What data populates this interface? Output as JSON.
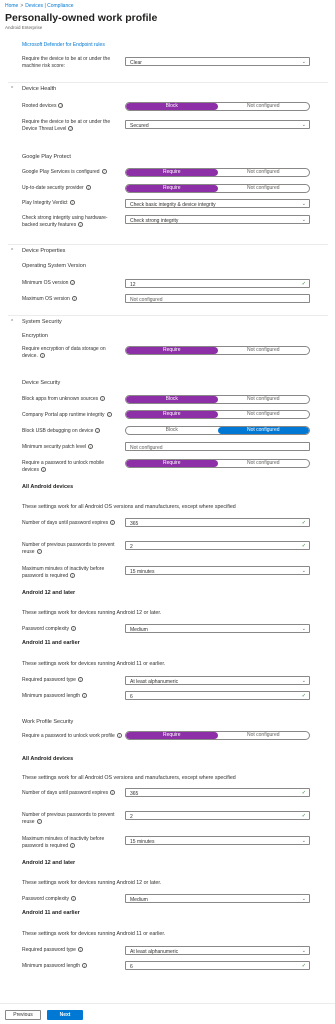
{
  "breadcrumb": {
    "home": "Home",
    "devices": "Devices | Compliance"
  },
  "page": {
    "title": "Personally-owned work profile",
    "subtitle": "Android Enterprise"
  },
  "defender_link": "Microsoft Defender for Endpoint rules",
  "risk_score": {
    "label": "Require the device to be at or under the machine risk score:",
    "value": "Clear"
  },
  "device_health": {
    "section": "Device Health",
    "rooted": {
      "label": "Rooted devices",
      "on": "Block",
      "off": "Not configured"
    },
    "threat_level": {
      "label": "Require the device to be at or under the Device Threat Level",
      "value": "Secured"
    },
    "google_play": "Google Play Protect",
    "gps_configured": {
      "label": "Google Play Services is configured",
      "on": "Require",
      "off": "Not configured"
    },
    "security_provider": {
      "label": "Up-to-date security provider",
      "on": "Require",
      "off": "Not configured"
    },
    "integrity_verdict": {
      "label": "Play Integrity Verdict",
      "value": "Check basic integrity & device integrity"
    },
    "strong_integrity": {
      "label": "Check strong integrity using hardware-backed security features",
      "value": "Check strong integrity"
    }
  },
  "device_properties": {
    "section": "Device Properties",
    "os_version": "Operating System Version",
    "min_os": {
      "label": "Minimum OS version",
      "value": "12"
    },
    "max_os": {
      "label": "Maximum OS version",
      "placeholder": "Not configured"
    }
  },
  "system_security": {
    "section": "System Security",
    "encryption": "Encryption",
    "encrypt_storage": {
      "label": "Require encryption of data storage on device.",
      "on": "Require",
      "off": "Not configured"
    },
    "device_security": "Device Security",
    "unknown_sources": {
      "label": "Block apps from unknown sources",
      "on": "Block",
      "off": "Not configured"
    },
    "portal_integrity": {
      "label": "Company Portal app runtime integrity",
      "on": "Require",
      "off": "Not configured"
    },
    "usb_debugging": {
      "label": "Block USB debugging on device",
      "left": "Block",
      "right": "Not configured"
    },
    "patch_level": {
      "label": "Minimum security patch level",
      "placeholder": "Not configured"
    },
    "password_unlock": {
      "label": "Require a password to unlock mobile devices",
      "on": "Require",
      "off": "Not configured"
    }
  },
  "pw1": {
    "all_android": "All Android devices",
    "all_note": "These settings work for all Android OS versions and manufacturers, except where specified",
    "expires": {
      "label": "Number of days until password expires",
      "value": "365"
    },
    "prev": {
      "label": "Number of previous passwords to prevent reuse",
      "value": "2"
    },
    "inactivity": {
      "label": "Maximum minutes of inactivity before password is required",
      "value": "15 minutes"
    },
    "a12": "Android 12 and later",
    "a12_note": "These settings work for devices running Android 12 or later.",
    "complexity": {
      "label": "Password complexity",
      "value": "Medium"
    },
    "a11": "Android 11 and earlier",
    "a11_note": "These settings work for devices running Android 11 or earlier.",
    "type": {
      "label": "Required password type",
      "value": "At least alphanumeric"
    },
    "length": {
      "label": "Minimum password length",
      "value": "6"
    }
  },
  "work_profile": {
    "heading": "Work Profile Security",
    "unlock": {
      "label": "Require a password to unlock work profile",
      "on": "Require",
      "off": "Not configured"
    }
  },
  "pw2": {
    "all_android": "All Android devices",
    "all_note": "These settings work for all Android OS versions and manufacturers, except where specified",
    "expires": {
      "label": "Number of days until password expires",
      "value": "365"
    },
    "prev": {
      "label": "Number of previous passwords to prevent reuse",
      "value": "2"
    },
    "inactivity": {
      "label": "Maximum minutes of inactivity before password is required",
      "value": "15 minutes"
    },
    "a12": "Android 12 and later",
    "a12_note": "These settings work for devices running Android 12 or later.",
    "complexity": {
      "label": "Password complexity",
      "value": "Medium"
    },
    "a11": "Android 11 and earlier",
    "a11_note": "These settings work for devices running Android 11 or earlier.",
    "type": {
      "label": "Required password type",
      "value": "At least alphanumeric"
    },
    "length": {
      "label": "Minimum password length",
      "value": "6"
    }
  },
  "footer": {
    "previous": "Previous",
    "next": "Next"
  },
  "colors": {
    "accent_purple": "#8d2fa6",
    "accent_blue": "#0078d4",
    "valid_green": "#107c10"
  }
}
